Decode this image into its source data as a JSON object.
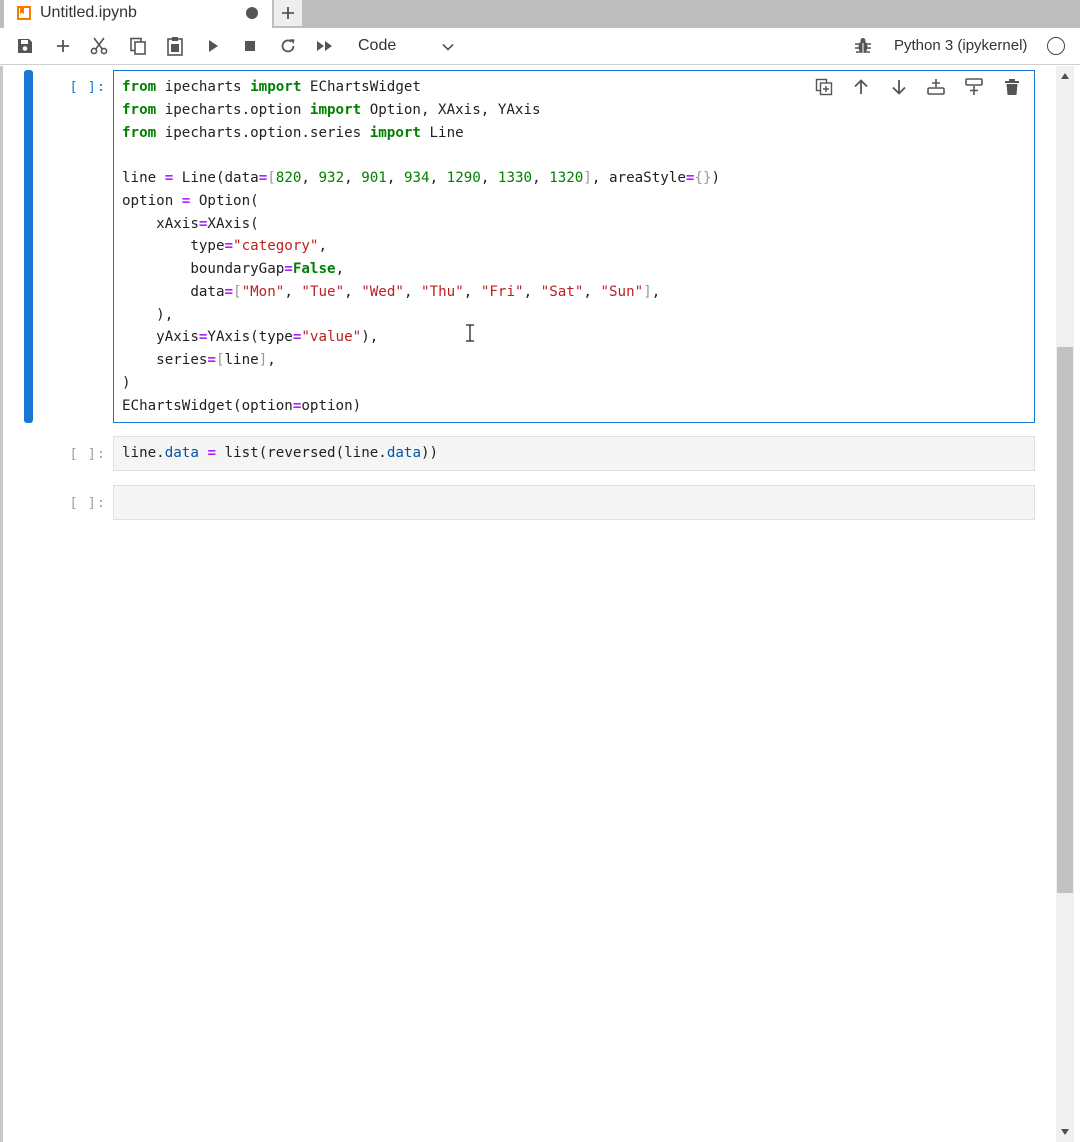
{
  "tab": {
    "title": "Untitled.ipynb",
    "unsaved_indicator": "dot-icon",
    "new_tab_icon": "plus-icon"
  },
  "toolbar": {
    "buttons": [
      "save-icon",
      "insert-cell-icon",
      "cut-icon",
      "copy-icon",
      "paste-icon",
      "run-icon",
      "stop-icon",
      "restart-icon",
      "run-all-icon"
    ],
    "cell_type": "Code",
    "debugger_icon": "bug-icon",
    "kernel_name": "Python 3 (ipykernel)",
    "kernel_status": "idle"
  },
  "cells": [
    {
      "prompt": "[ ]:",
      "lines": [
        "from ipecharts import EChartsWidget",
        "from ipecharts.option import Option, XAxis, YAxis",
        "from ipecharts.option.series import Line",
        "",
        "line = Line(data=[820, 932, 901, 934, 1290, 1330, 1320], areaStyle={})",
        "option = Option(",
        "    xAxis=XAxis(",
        "        type=\"category\",",
        "        boundaryGap=False,",
        "        data=[\"Mon\", \"Tue\", \"Wed\", \"Thu\", \"Fri\", \"Sat\", \"Sun\"],",
        "    ),",
        "    yAxis=YAxis(type=\"value\"),",
        "    series=[line],",
        ")",
        "EChartsWidget(option=option)"
      ]
    },
    {
      "prompt": "[ ]:",
      "lines": [
        "line.data = list(reversed(line.data))"
      ]
    },
    {
      "prompt": "[ ]:",
      "lines": [
        ""
      ]
    }
  ],
  "cell_toolbar": [
    "duplicate-icon",
    "move-up-icon",
    "move-down-icon",
    "insert-above-icon",
    "insert-below-icon",
    "delete-icon"
  ],
  "colors": {
    "accent": "#1976d2",
    "keyword": "#008000",
    "operator": "#aa22ff",
    "string": "#ba2121"
  }
}
